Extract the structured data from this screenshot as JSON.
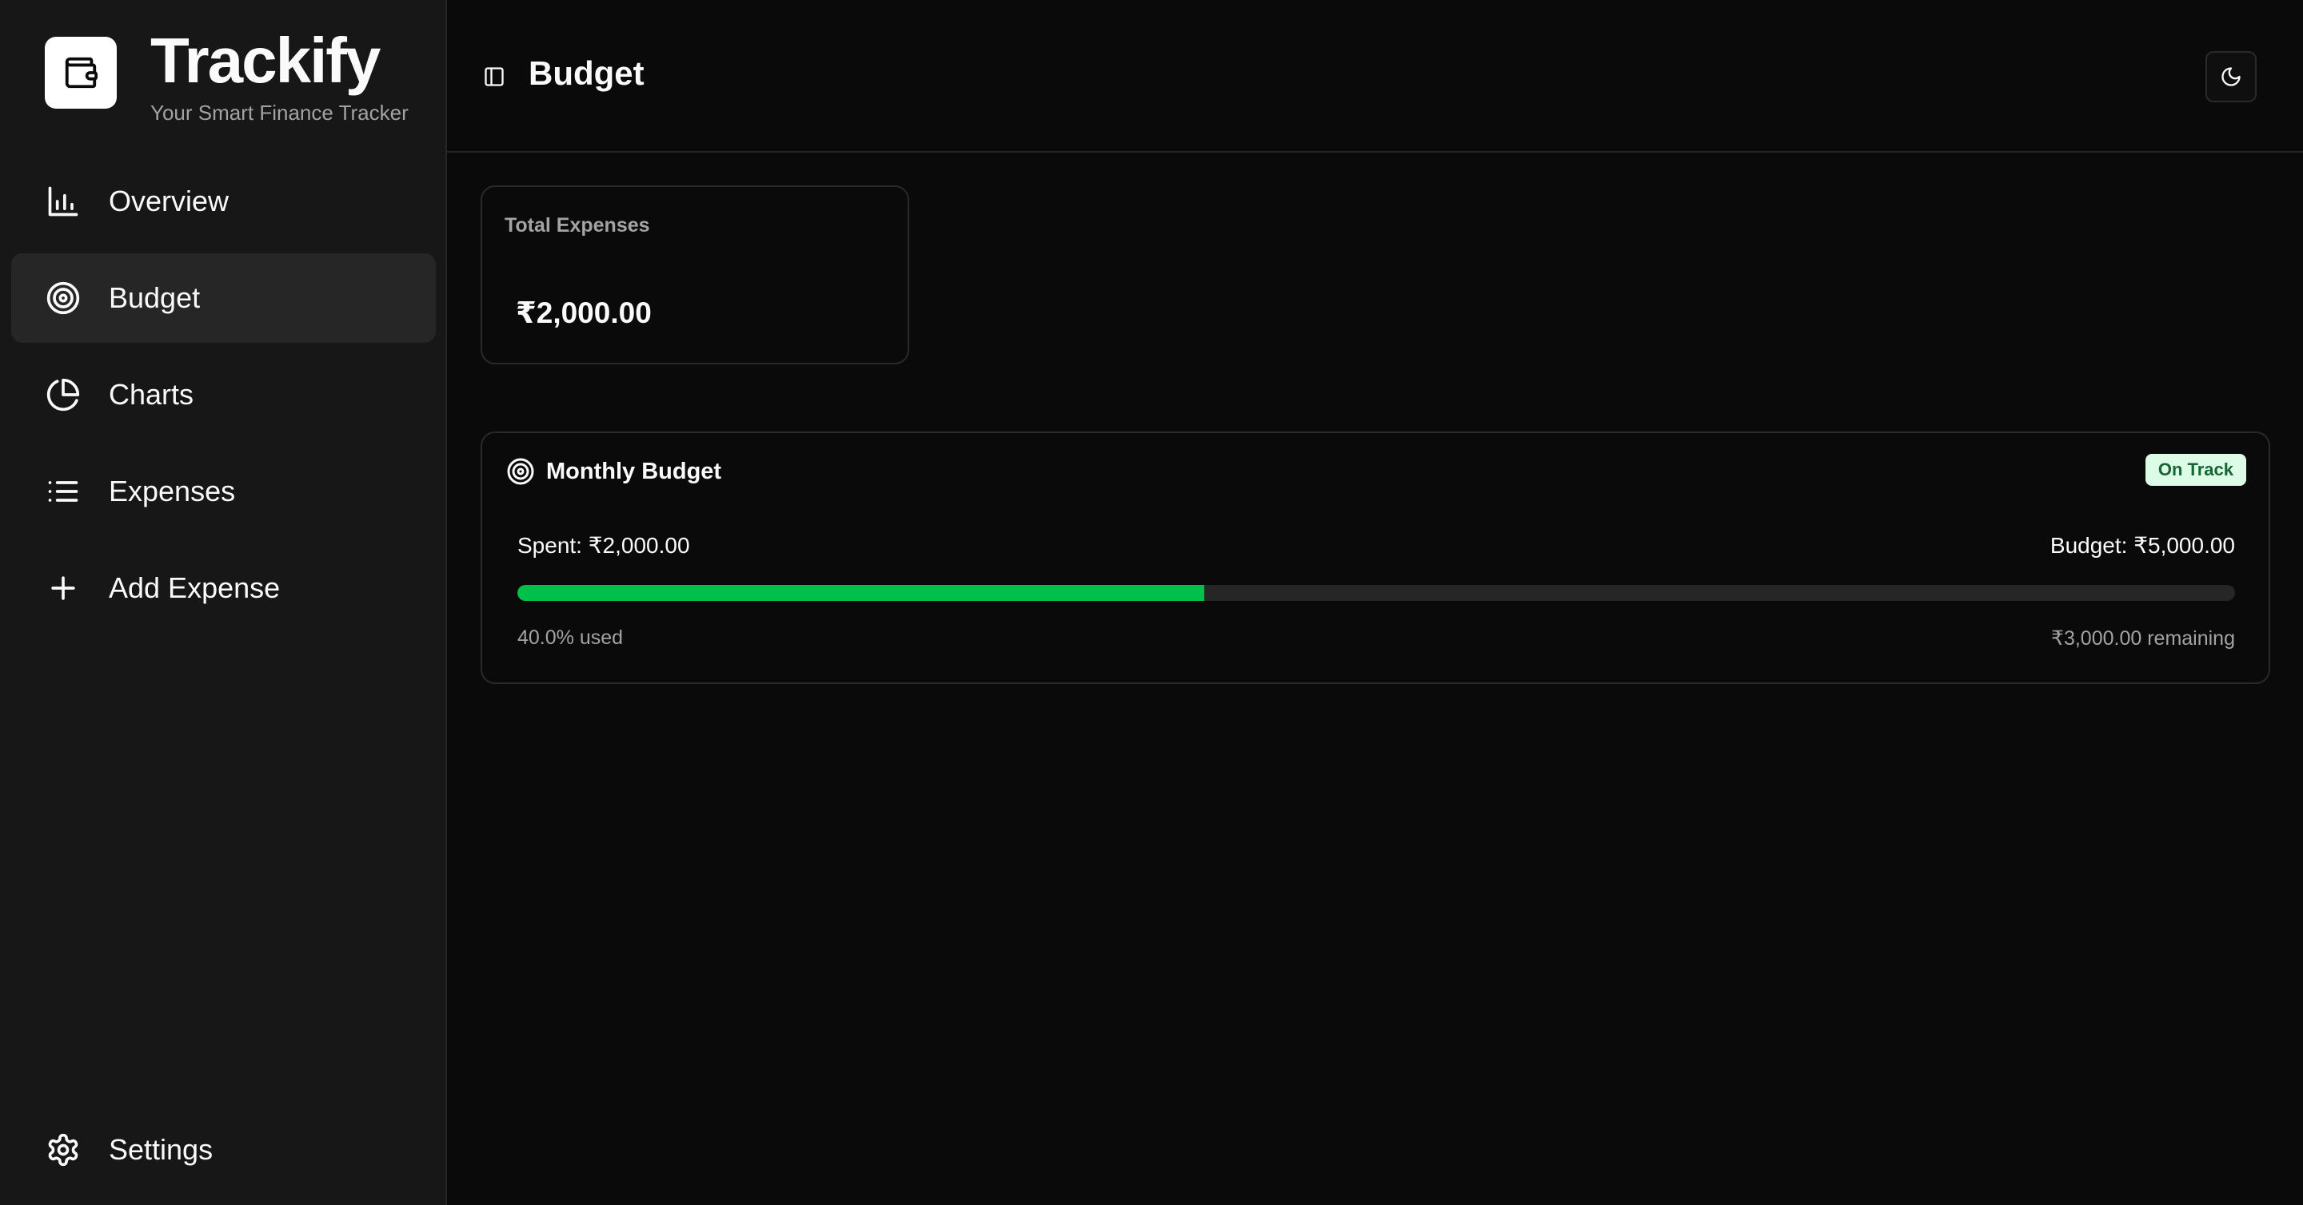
{
  "brand": {
    "name": "Trackify",
    "tagline": "Your Smart Finance Tracker",
    "logo_icon": "wallet-icon"
  },
  "nav": {
    "items": [
      {
        "label": "Overview",
        "icon": "bar-chart-icon"
      },
      {
        "label": "Budget",
        "icon": "target-icon",
        "active": true
      },
      {
        "label": "Charts",
        "icon": "pie-chart-icon"
      },
      {
        "label": "Expenses",
        "icon": "list-icon"
      },
      {
        "label": "Add Expense",
        "icon": "plus-icon"
      }
    ],
    "settings": {
      "label": "Settings",
      "icon": "gear-icon"
    }
  },
  "header": {
    "title": "Budget",
    "toggle_icon": "panel-left-icon",
    "theme_icon": "moon-icon"
  },
  "total_expenses": {
    "label": "Total Expenses",
    "value": "₹2,000.00"
  },
  "monthly_budget": {
    "title": "Monthly Budget",
    "status": "On Track",
    "spent_text": "Spent: ₹2,000.00",
    "budget_text": "Budget: ₹5,000.00",
    "used_text": "40.0% used",
    "remaining_text": "₹3,000.00 remaining",
    "progress_fraction": 0.4
  },
  "colors": {
    "accent_green": "#00c04b",
    "badge_bg": "#dcfce7",
    "badge_text": "#166534",
    "background": "#0a0a0a",
    "sidebar": "#171717"
  }
}
